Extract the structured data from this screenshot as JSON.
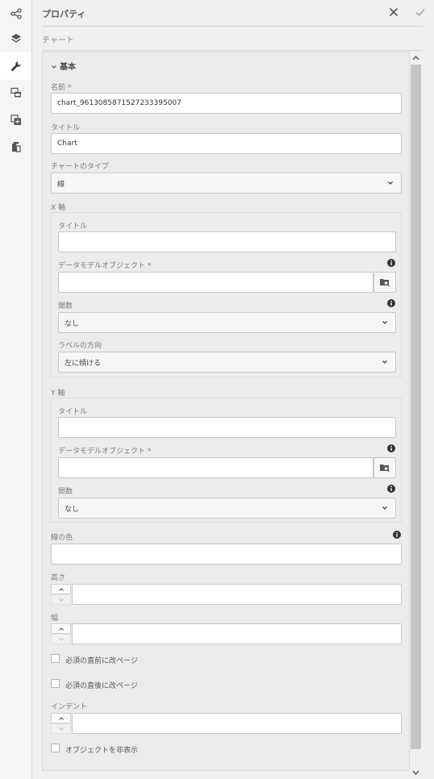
{
  "rail": {
    "items": [
      {
        "icon": "share-icon"
      },
      {
        "icon": "layers-icon"
      },
      {
        "icon": "wrench-icon"
      },
      {
        "icon": "copy-windows-icon"
      },
      {
        "icon": "add-copy-icon"
      },
      {
        "icon": "objects-icon"
      }
    ]
  },
  "header": {
    "title": "プロパティ",
    "subtitle": "チャート"
  },
  "section": {
    "title": "基本"
  },
  "form": {
    "name_label": "名前 *",
    "name_value": "chart_9613085871527233395007",
    "title_label": "タイトル",
    "title_value": "Chart",
    "chart_type_label": "チャートのタイプ",
    "chart_type_value": "線",
    "x_axis": {
      "label": "X 軸",
      "title_label": "タイトル",
      "title_value": "",
      "dmo_label": "データモデルオブジェクト *",
      "dmo_value": "",
      "function_label": "関数",
      "function_value": "なし",
      "label_orientation_label": "ラベルの方向",
      "label_orientation_value": "左に傾ける"
    },
    "y_axis": {
      "label": "Y 軸",
      "title_label": "タイトル",
      "title_value": "",
      "dmo_label": "データモデルオブジェクト *",
      "dmo_value": "",
      "function_label": "関数",
      "function_value": "なし"
    },
    "line_color_label": "線の色",
    "line_color_value": "",
    "height_label": "高さ",
    "height_value": "",
    "width_label": "幅",
    "width_value": "",
    "page_break_before_label": "必須の直前に改ページ",
    "page_break_after_label": "必須の直後に改ページ",
    "indent_label": "インデント",
    "indent_value": "",
    "hide_object_label": "オブジェクトを非表示"
  }
}
